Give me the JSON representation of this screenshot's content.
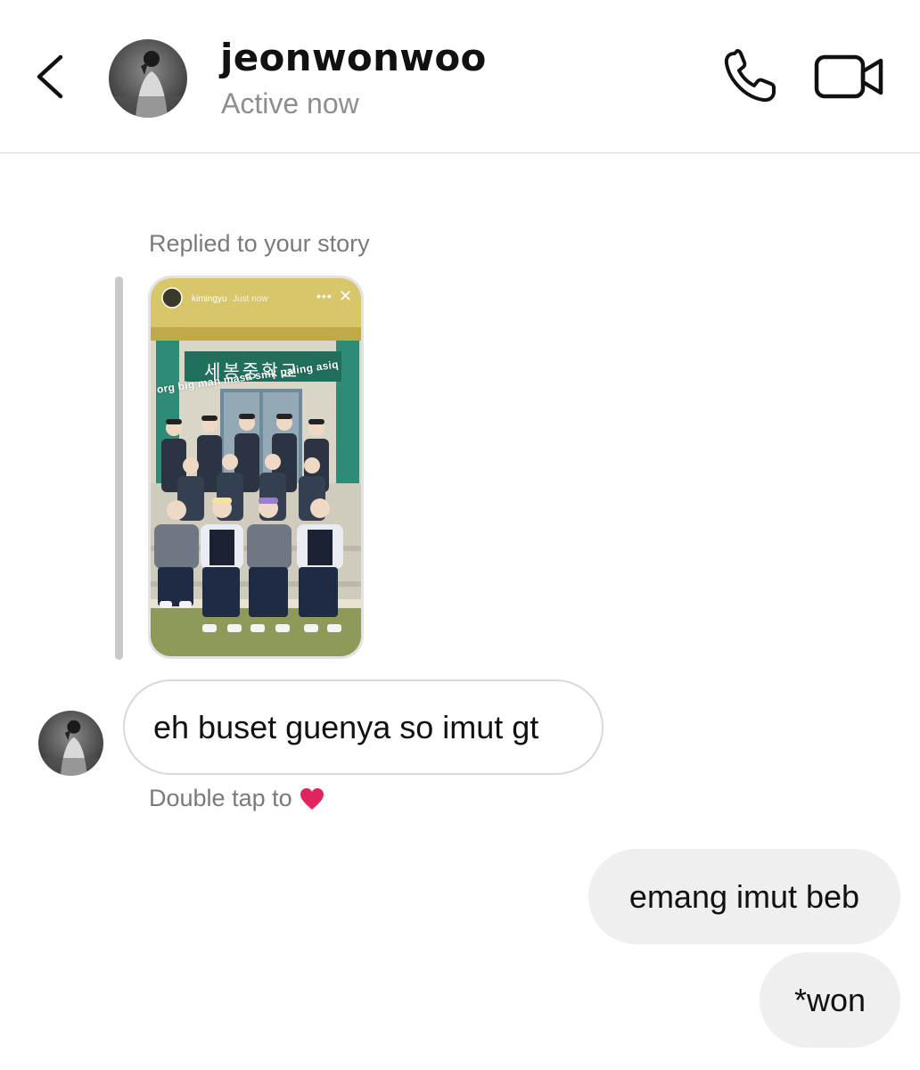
{
  "header": {
    "title": "jeonwonwoo",
    "status": "Active now",
    "back_icon": "chevron-left-icon",
    "call_icon": "phone-icon",
    "video_icon": "video-camera-icon"
  },
  "story_reply": {
    "label": "Replied to your story",
    "story_username": "kimingyu",
    "story_time": "Just now",
    "story_caption": "org big mah masa smk paling asiq",
    "sign_text": "세봉중학교"
  },
  "messages": [
    {
      "sender": "them",
      "text": "eh buset guenya so imut gt"
    },
    {
      "sender": "me",
      "text": "emang imut beb"
    },
    {
      "sender": "me",
      "text": "*won"
    }
  ],
  "hint": {
    "text": "Double tap to",
    "icon": "heart-icon",
    "color": "#e0245e"
  },
  "colors": {
    "secondary_text": "#8e8e8e",
    "outgoing_bubble": "#efefef",
    "incoming_border": "#d8d8d8"
  }
}
